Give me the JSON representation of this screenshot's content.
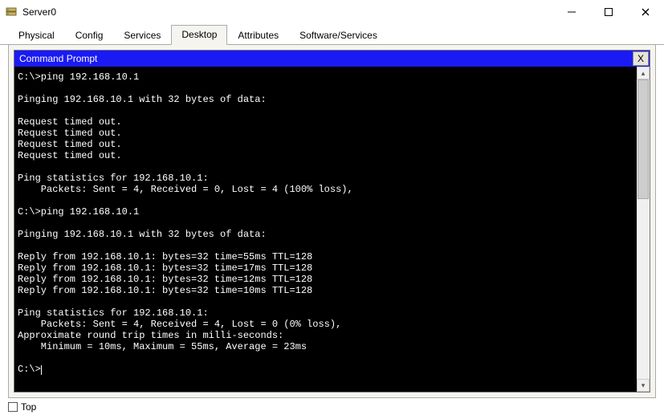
{
  "window": {
    "title": "Server0"
  },
  "tabs": {
    "items": [
      {
        "label": "Physical"
      },
      {
        "label": "Config"
      },
      {
        "label": "Services"
      },
      {
        "label": "Desktop"
      },
      {
        "label": "Attributes"
      },
      {
        "label": "Software/Services"
      }
    ],
    "active_index": 3
  },
  "cmd": {
    "title": "Command Prompt",
    "close_label": "X",
    "lines": [
      "C:\\>ping 192.168.10.1",
      "",
      "Pinging 192.168.10.1 with 32 bytes of data:",
      "",
      "Request timed out.",
      "Request timed out.",
      "Request timed out.",
      "Request timed out.",
      "",
      "Ping statistics for 192.168.10.1:",
      "    Packets: Sent = 4, Received = 0, Lost = 4 (100% loss),",
      "",
      "C:\\>ping 192.168.10.1",
      "",
      "Pinging 192.168.10.1 with 32 bytes of data:",
      "",
      "Reply from 192.168.10.1: bytes=32 time=55ms TTL=128",
      "Reply from 192.168.10.1: bytes=32 time=17ms TTL=128",
      "Reply from 192.168.10.1: bytes=32 time=12ms TTL=128",
      "Reply from 192.168.10.1: bytes=32 time=10ms TTL=128",
      "",
      "Ping statistics for 192.168.10.1:",
      "    Packets: Sent = 4, Received = 4, Lost = 0 (0% loss),",
      "Approximate round trip times in milli-seconds:",
      "    Minimum = 10ms, Maximum = 55ms, Average = 23ms",
      ""
    ],
    "prompt": "C:\\>"
  },
  "footer": {
    "top_label": "Top"
  }
}
